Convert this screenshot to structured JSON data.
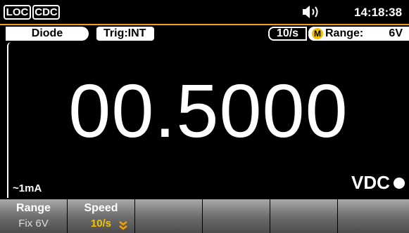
{
  "status": {
    "loc": "LOC",
    "cdc": "CDC",
    "speaker_icon": "speaker-icon",
    "clock": "14:18:38"
  },
  "modebar": {
    "function": "Diode",
    "trigger": "Trig:INT",
    "rate": "10/s",
    "manual_badge": "M",
    "range_label": "Range:",
    "range_value": "6V"
  },
  "display": {
    "reading": "00.5000",
    "test_current": "~1mA",
    "unit": "VDC"
  },
  "softkeys": [
    {
      "title": "Range",
      "value": "Fix 6V"
    },
    {
      "title": "Speed",
      "value": "10/s"
    },
    {
      "title": "",
      "value": ""
    },
    {
      "title": "",
      "value": ""
    },
    {
      "title": "",
      "value": ""
    },
    {
      "title": "",
      "value": ""
    }
  ],
  "colors": {
    "accent": "#f0a020",
    "badge": "#f0c000",
    "speed_value": "#f5c400"
  }
}
